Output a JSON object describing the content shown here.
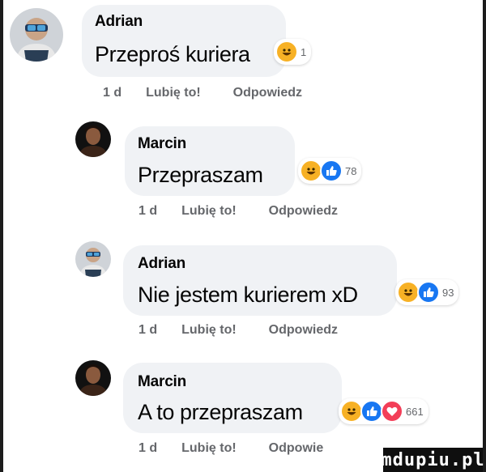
{
  "comments": [
    {
      "author": "Adrian",
      "text": "Przeproś kuriera",
      "reactions": [
        "haha"
      ],
      "count": "1",
      "time": "1 d",
      "like": "Lubię to!",
      "reply": "Odpowiedz"
    },
    {
      "author": "Marcin",
      "text": "Przepraszam",
      "reactions": [
        "haha",
        "like"
      ],
      "count": "78",
      "time": "1 d",
      "like": "Lubię to!",
      "reply": "Odpowiedz"
    },
    {
      "author": "Adrian",
      "text": "Nie jestem kurierem xD",
      "reactions": [
        "haha",
        "like"
      ],
      "count": "93",
      "time": "1 d",
      "like": "Lubię to!",
      "reply": "Odpowiedz"
    },
    {
      "author": "Marcin",
      "text": "A to przepraszam",
      "reactions": [
        "haha",
        "like",
        "love"
      ],
      "count": "661",
      "time": "1 d",
      "like": "Lubię to!",
      "reply": "Odpowie"
    }
  ],
  "watermark": "mdupiu.pl",
  "colors": {
    "bubble": "#f0f2f5",
    "meta": "#65676b",
    "like": "#1877f2",
    "love": "#f33e58",
    "haha": "#f7b125"
  }
}
